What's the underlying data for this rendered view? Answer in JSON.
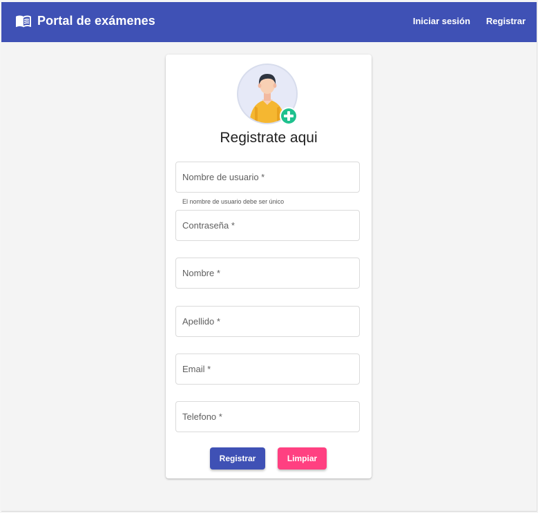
{
  "header": {
    "title": "Portal de exámenes",
    "brand_icon": "menu-book-icon",
    "nav": {
      "login": "Iniciar sesión",
      "register": "Registrar"
    }
  },
  "form": {
    "avatar_icon": "user-add-avatar-icon",
    "title": "Registrate aqui",
    "fields": {
      "username": {
        "label": "Nombre de usuario *",
        "value": "",
        "hint": "El nombre de usuario debe ser único"
      },
      "password": {
        "label": "Contraseña *",
        "value": ""
      },
      "first_name": {
        "label": "Nombre *",
        "value": ""
      },
      "last_name": {
        "label": "Apellido *",
        "value": ""
      },
      "email": {
        "label": "Email *",
        "value": ""
      },
      "phone": {
        "label": "Telefono *",
        "value": ""
      }
    },
    "buttons": {
      "submit": "Registrar",
      "clear": "Limpiar"
    }
  },
  "colors": {
    "primary": "#3f51b5",
    "accent": "#ff4081",
    "background": "#f4f4f4"
  }
}
